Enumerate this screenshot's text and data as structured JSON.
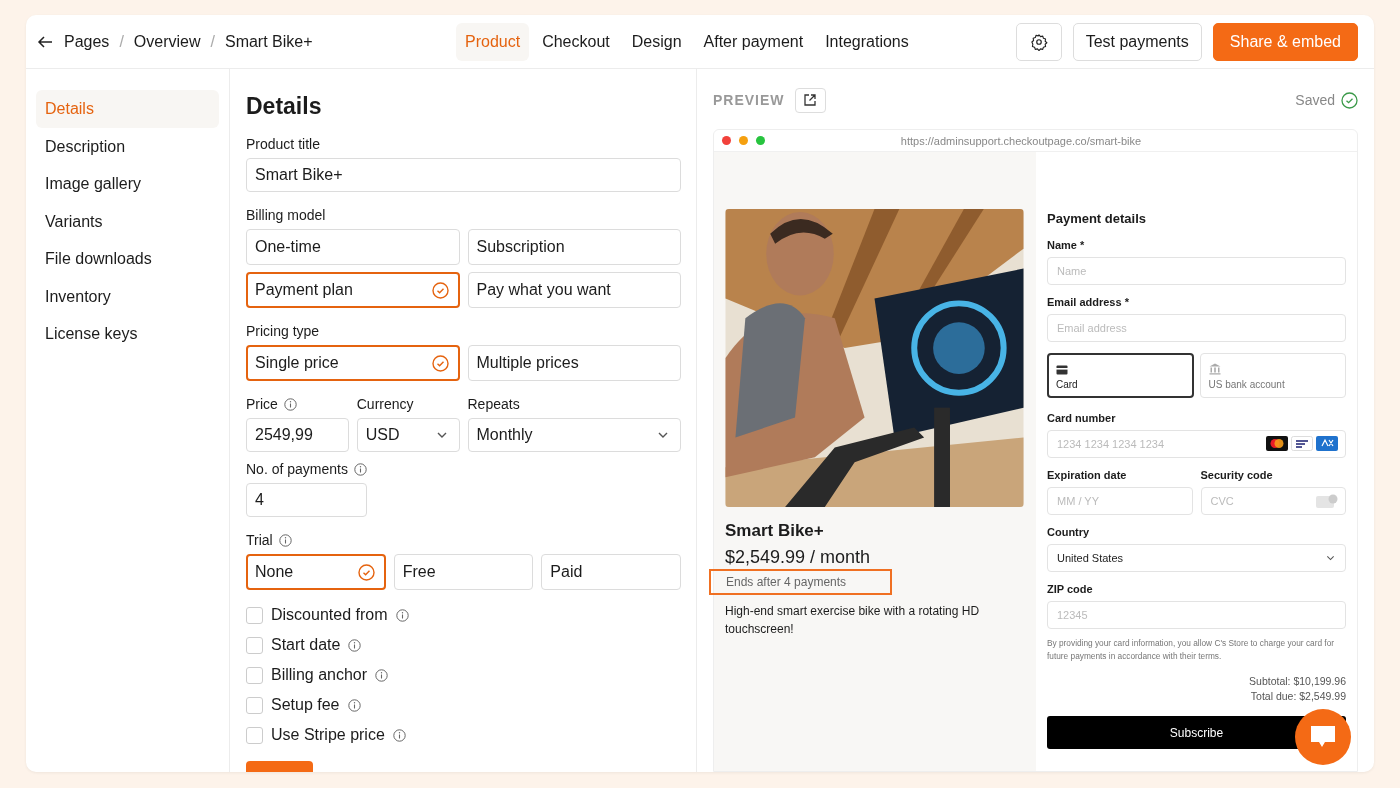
{
  "header": {
    "breadcrumbs": {
      "items": [
        "Pages",
        "Overview",
        "Smart Bike+"
      ],
      "separator": "/"
    },
    "tabs": [
      {
        "label": "Product",
        "selected": true
      },
      {
        "label": "Checkout",
        "selected": false
      },
      {
        "label": "Design",
        "selected": false
      },
      {
        "label": "After payment",
        "selected": false
      },
      {
        "label": "Integrations",
        "selected": false
      }
    ],
    "actions": [
      {
        "kind": "settings"
      },
      {
        "kind": "secondary",
        "label": "Test payments"
      },
      {
        "kind": "primary",
        "label": "Share & embed"
      }
    ]
  },
  "sidebar": {
    "items": [
      {
        "label": "Details",
        "selected": true
      },
      {
        "label": "Description",
        "selected": false
      },
      {
        "label": "Image gallery",
        "selected": false
      },
      {
        "label": "Variants",
        "selected": false
      },
      {
        "label": "File downloads",
        "selected": false
      },
      {
        "label": "Inventory",
        "selected": false
      },
      {
        "label": "License keys",
        "selected": false
      }
    ]
  },
  "form": {
    "heading": "Details",
    "product_title": {
      "label": "Product title",
      "value": "Smart Bike+"
    },
    "billing_model": {
      "label": "Billing model",
      "options": [
        {
          "label": "One-time",
          "selected": false
        },
        {
          "label": "Subscription",
          "selected": false
        },
        {
          "label": "Payment plan",
          "selected": true
        },
        {
          "label": "Pay what you want",
          "selected": false
        }
      ]
    },
    "pricing_type": {
      "label": "Pricing type",
      "options": [
        {
          "label": "Single price",
          "selected": true
        },
        {
          "label": "Multiple prices",
          "selected": false
        }
      ]
    },
    "price": {
      "label": "Price",
      "info": true,
      "value": "2549,99"
    },
    "currency": {
      "label": "Currency",
      "value": "USD"
    },
    "repeats": {
      "label": "Repeats",
      "value": "Monthly"
    },
    "payments": {
      "label": "No. of payments",
      "info": true,
      "value": "4"
    },
    "trial": {
      "label": "Trial",
      "info": true,
      "options": [
        {
          "label": "None",
          "selected": true
        },
        {
          "label": "Free",
          "selected": false
        },
        {
          "label": "Paid",
          "selected": false
        }
      ]
    },
    "checkboxes": [
      {
        "label": "Discounted from",
        "checked": false
      },
      {
        "label": "Start date",
        "checked": false
      },
      {
        "label": "Billing anchor",
        "checked": false
      },
      {
        "label": "Setup fee",
        "checked": false
      },
      {
        "label": "Use Stripe price",
        "checked": false
      }
    ]
  },
  "preview": {
    "label": "PREVIEW",
    "status": "Saved",
    "browser": {
      "url": "https://adminsupport.checkoutpage.co/smart-bike"
    },
    "product": {
      "name": "Smart Bike+",
      "price": "$2,549.99 / month",
      "note": {
        "text": "Ends after 4 payments",
        "highlighted": true
      },
      "description": "High-end smart exercise bike with a rotating HD touchscreen!"
    },
    "payment": {
      "heading": "Payment details",
      "name": {
        "label": "Name *",
        "placeholder": "Name"
      },
      "email": {
        "label": "Email address *",
        "placeholder": "Email address"
      },
      "methods": [
        {
          "kind": "card",
          "label": "Card",
          "selected": true
        },
        {
          "kind": "bank",
          "label": "US bank account",
          "selected": false
        }
      ],
      "card_number": {
        "label": "Card number",
        "placeholder": "1234 1234 1234 1234"
      },
      "expiration": {
        "label": "Expiration date",
        "placeholder": "MM / YY"
      },
      "security": {
        "label": "Security code",
        "placeholder": "CVC"
      },
      "country": {
        "label": "Country",
        "value": "United States"
      },
      "zip": {
        "label": "ZIP code",
        "placeholder": "12345"
      },
      "terms": "By providing your card information, you allow C's Store to charge your card for future payments in accordance with their terms.",
      "subtotal": "Subtotal: $10,199.96",
      "total": "Total due: $2,549.99",
      "button": "Subscribe"
    }
  }
}
